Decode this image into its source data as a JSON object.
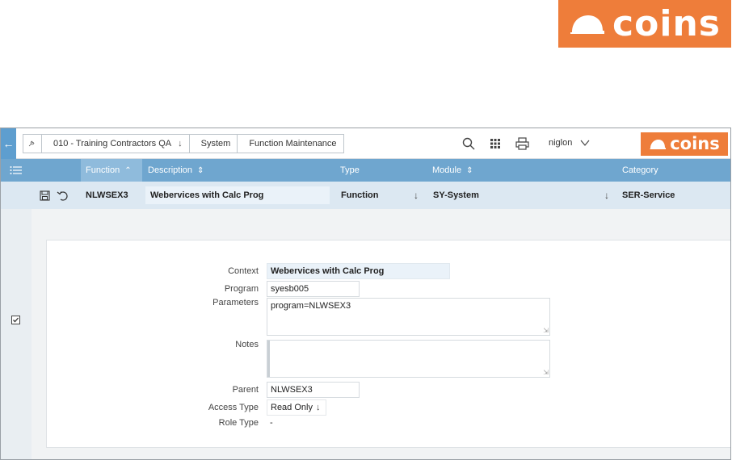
{
  "brand": {
    "name": "coins",
    "color": "#ee7d3a"
  },
  "toolbar": {
    "back_icon": "arrow-left-icon",
    "tools_icon": "wrench-icon",
    "breadcrumbs": [
      "010 - Training Contractors QA",
      "System",
      "Function Maintenance"
    ],
    "user": "niglon"
  },
  "grid": {
    "columns": [
      "Function",
      "Description",
      "Type",
      "Module",
      "Category"
    ],
    "row": {
      "function": "NLWSEX3",
      "description": "Webervices with Calc Prog",
      "type": "Function",
      "module": "SY-System",
      "category": "SER-Service"
    }
  },
  "detail": {
    "context_label": "Context",
    "context_value": "Webervices with Calc Prog",
    "program_label": "Program",
    "program_value": "syesb005",
    "parameters_label": "Parameters",
    "parameters_value": "program=NLWSEX3",
    "notes_label": "Notes",
    "notes_value": "",
    "parent_label": "Parent",
    "parent_value": "NLWSEX3",
    "access_type_label": "Access Type",
    "access_type_value": "Read Only",
    "role_type_label": "Role Type",
    "role_type_value": "-"
  }
}
